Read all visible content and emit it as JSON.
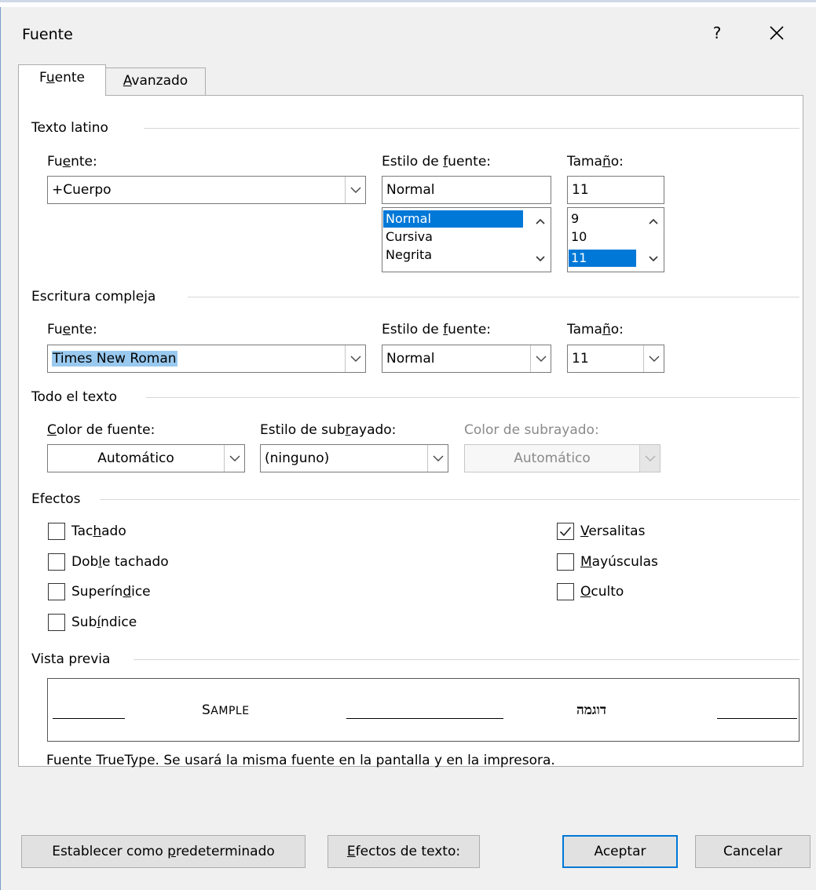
{
  "dialog": {
    "title": "Fuente",
    "help_label": "?"
  },
  "tabs": [
    {
      "pre": "F",
      "key": "u",
      "post": "ente"
    },
    {
      "pre": "",
      "key": "A",
      "post": "vanzado"
    }
  ],
  "latin": {
    "section": "Texto latino",
    "font_label": {
      "pre": "Fu",
      "key": "e",
      "post": "nte:"
    },
    "font_value": "+Cuerpo",
    "style_label": {
      "pre": "Estilo de ",
      "key": "f",
      "post": "uente:"
    },
    "style_value": "Normal",
    "style_list": [
      "Normal",
      "Cursiva",
      "Negrita"
    ],
    "size_label": {
      "pre": "Tama",
      "key": "ñ",
      "post": "o:"
    },
    "size_value": "11",
    "size_list": [
      "9",
      "10",
      "11"
    ]
  },
  "complex": {
    "section": "Escritura compleja",
    "font_label": {
      "pre": "Fu",
      "key": "e",
      "post": "nte:"
    },
    "font_value": "Times New Roman",
    "style_label": {
      "pre": "Estilo de ",
      "key": "f",
      "post": "uente:"
    },
    "style_value": "Normal",
    "size_label": {
      "pre": "Tama",
      "key": "ñ",
      "post": "o:"
    },
    "size_value": "11"
  },
  "all_text": {
    "section": "Todo el texto",
    "color_label": {
      "pre": "",
      "key": "C",
      "post": "olor de fuente:"
    },
    "color_value": "Automático",
    "underline_label": {
      "pre": "Estilo de sub",
      "key": "r",
      "post": "ayado:"
    },
    "underline_value": "(ninguno)",
    "underline_color_label": "Color de subrayado:",
    "underline_color_value": "Automático"
  },
  "effects": {
    "section": "Efectos",
    "left": [
      {
        "pre": "Tac",
        "key": "h",
        "post": "ado",
        "checked": false
      },
      {
        "pre": "Dob",
        "key": "l",
        "post": "e tachado",
        "checked": false
      },
      {
        "pre": "Superín",
        "key": "d",
        "post": "ice",
        "checked": false
      },
      {
        "pre": "Sub",
        "key": "í",
        "post": "ndice",
        "checked": false
      }
    ],
    "right": [
      {
        "pre": "",
        "key": "V",
        "post": "ersalitas",
        "checked": true
      },
      {
        "pre": "",
        "key": "M",
        "post": "ayúsculas",
        "checked": false
      },
      {
        "pre": "",
        "key": "O",
        "post": "culto",
        "checked": false
      }
    ]
  },
  "preview": {
    "section": "Vista previa",
    "sample_first": "S",
    "sample_rest": "AMPLE",
    "hebrew": "דוגמה",
    "info": "Fuente TrueType. Se usará la misma fuente en la pantalla y en la impresora."
  },
  "buttons": {
    "set_default": {
      "pre": "Establecer como ",
      "key": "p",
      "post": "redeterminado"
    },
    "text_effects": {
      "pre": "",
      "key": "E",
      "post": "fectos de texto:"
    },
    "ok": "Aceptar",
    "cancel": "Cancelar"
  },
  "colors": {
    "accent": "#0078d7",
    "selection": "#99c9ef",
    "dialog_bg": "#f0f0f0"
  }
}
